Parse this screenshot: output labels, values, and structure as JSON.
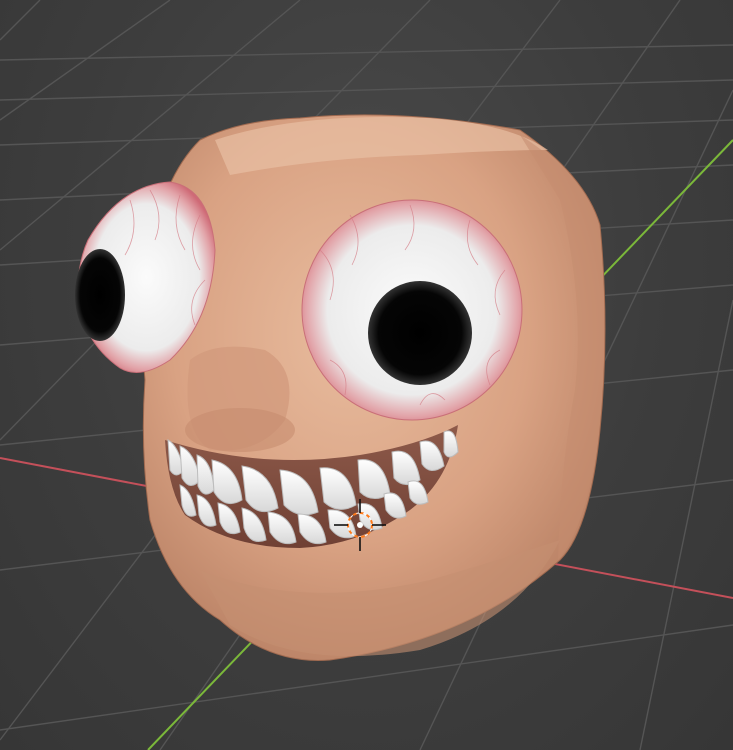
{
  "viewport": {
    "kind": "3d-viewport",
    "background_color": "#3d3d3d",
    "grid_color": "#555555",
    "x_axis_color": "#c4505a",
    "y_axis_color": "#7bb83a"
  },
  "object": {
    "kind": "cartoon-head-mesh",
    "skin_color": "#dba687",
    "sclera_color": "#f2f2f2",
    "vein_color": "#d4707a",
    "pupil_color": "#000000",
    "teeth_color": "#f5f5f5"
  },
  "cursor_3d": {
    "icon": "3d-cursor-icon",
    "ring_color": "#ff7a1a",
    "dot_color": "#ffffff"
  }
}
